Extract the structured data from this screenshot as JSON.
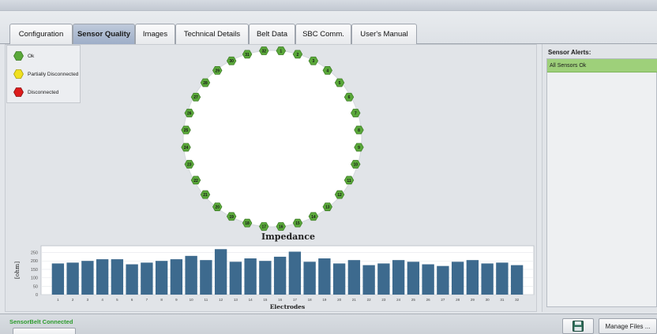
{
  "tabs": [
    {
      "label": "Configuration",
      "active": false
    },
    {
      "label": "Sensor Quality",
      "active": true
    },
    {
      "label": "Images",
      "active": false
    },
    {
      "label": "Technical Details",
      "active": false
    },
    {
      "label": "Belt Data",
      "active": false
    },
    {
      "label": "SBC Comm.",
      "active": false
    },
    {
      "label": "User's Manual",
      "active": false
    }
  ],
  "legend": {
    "ok": "Ok",
    "partial": "Partially Disconnected",
    "disconnected": "Disconnected"
  },
  "colors": {
    "ok": "#5aa83a",
    "partial": "#f0e020",
    "disconnected": "#dd1c1c",
    "bar": "#3d6a8e",
    "alert_ok": "#9ed07a",
    "status_text": "#2d9c2d"
  },
  "electrodes": {
    "labels": [
      "1",
      "2",
      "3",
      "4",
      "5",
      "6",
      "7",
      "8",
      "9",
      "10",
      "11",
      "12",
      "13",
      "14",
      "15",
      "16",
      "17",
      "18",
      "19",
      "20",
      "21",
      "22",
      "23",
      "24",
      "25",
      "26",
      "27",
      "28",
      "29",
      "30",
      "31",
      "32"
    ],
    "status": [
      "ok",
      "ok",
      "ok",
      "ok",
      "ok",
      "ok",
      "ok",
      "ok",
      "ok",
      "ok",
      "ok",
      "ok",
      "ok",
      "ok",
      "ok",
      "ok",
      "ok",
      "ok",
      "ok",
      "ok",
      "ok",
      "ok",
      "ok",
      "ok",
      "ok",
      "ok",
      "ok",
      "ok",
      "ok",
      "ok",
      "ok",
      "ok"
    ]
  },
  "chart_data": {
    "type": "bar",
    "title": "Impedance",
    "xlabel": "Electrodes",
    "ylabel": "[ohm]",
    "categories": [
      "1",
      "2",
      "3",
      "4",
      "5",
      "6",
      "7",
      "8",
      "9",
      "10",
      "11",
      "12",
      "13",
      "14",
      "15",
      "16",
      "17",
      "18",
      "19",
      "20",
      "21",
      "22",
      "23",
      "24",
      "25",
      "26",
      "27",
      "28",
      "29",
      "30",
      "31",
      "32"
    ],
    "values": [
      185,
      190,
      200,
      210,
      210,
      180,
      190,
      200,
      210,
      230,
      205,
      270,
      195,
      215,
      200,
      225,
      255,
      195,
      215,
      185,
      205,
      175,
      185,
      205,
      195,
      180,
      170,
      195,
      205,
      185,
      190,
      175
    ],
    "yticks": [
      "0",
      "50",
      "100",
      "150",
      "200",
      "250"
    ],
    "ylim": [
      0,
      290
    ],
    "grid": true
  },
  "sidebar": {
    "alerts_title": "Sensor Alerts:",
    "alerts": [
      "All Sensors Ok"
    ]
  },
  "footer": {
    "status": "SensorBelt Connected",
    "manage_files": "Manage Files ...",
    "save_icon": "save-icon"
  }
}
